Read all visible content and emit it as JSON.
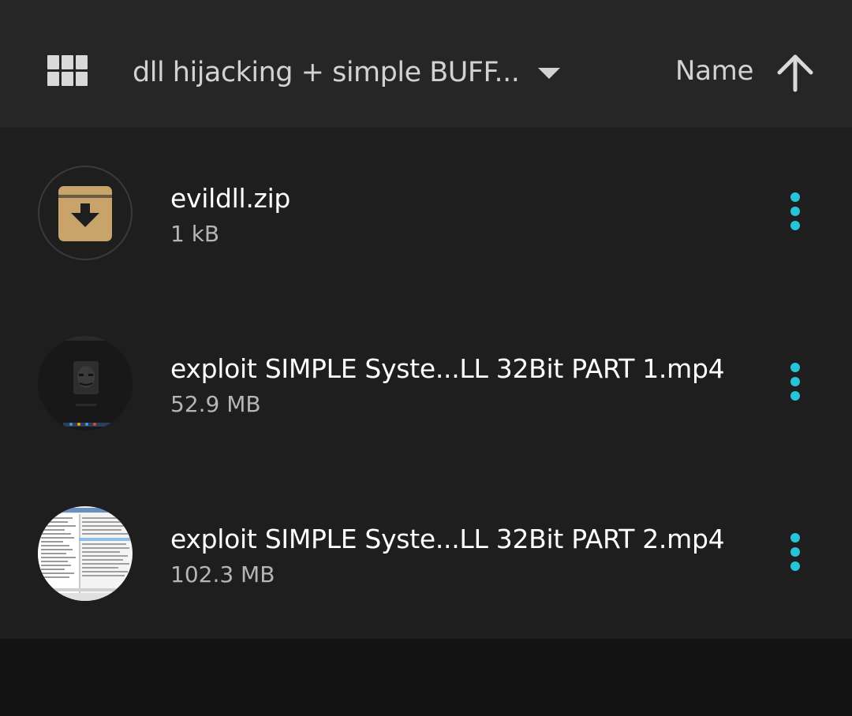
{
  "toolbar": {
    "view_toggle_icon": "grid-view-icon",
    "folder_title": "dll hijacking + simple BUFF...",
    "folder_dropdown_icon": "caret-down-icon",
    "sort_label": "Name",
    "sort_direction_icon": "arrow-up-icon"
  },
  "colors": {
    "toolbar_bg": "#262626",
    "list_bg": "#1e1e1e",
    "accent": "#27c3d8",
    "archive_icon": "#c8a46a"
  },
  "files": [
    {
      "name": "evildll.zip",
      "size": "1 kB",
      "thumbnail": "archive-icon"
    },
    {
      "name": "exploit SIMPLE Syste...LL 32Bit PART 1.mp4",
      "size": "52.9 MB",
      "thumbnail": "video-thumbnail"
    },
    {
      "name": "exploit SIMPLE Syste...LL 32Bit PART 2.mp4",
      "size": "102.3 MB",
      "thumbnail": "video-thumbnail"
    }
  ]
}
